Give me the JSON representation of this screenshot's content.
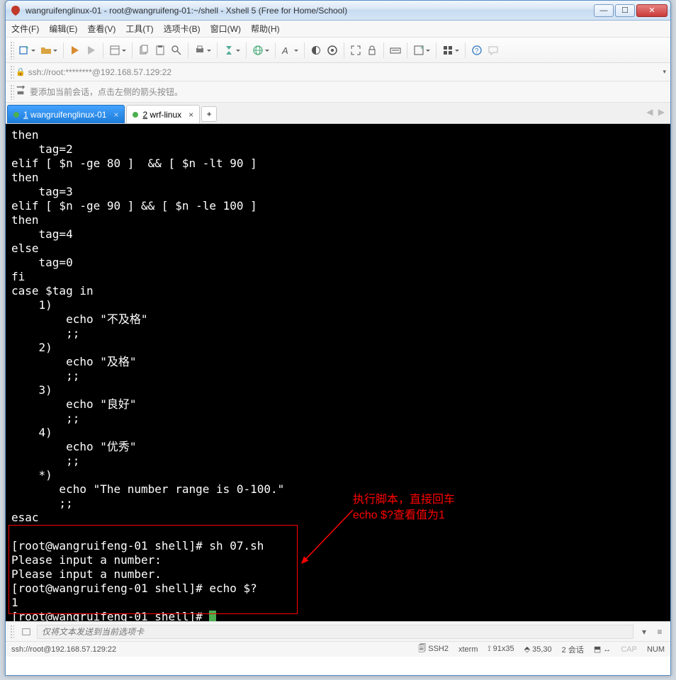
{
  "window": {
    "title": "wangruifenglinux-01 - root@wangruifeng-01:~/shell - Xshell 5 (Free for Home/School)"
  },
  "menu": {
    "file": "文件(F)",
    "edit": "编辑(E)",
    "view": "查看(V)",
    "tools": "工具(T)",
    "tabs": "选项卡(B)",
    "window": "窗口(W)",
    "help": "帮助(H)"
  },
  "address": {
    "url": "ssh://root:********@192.168.57.129:22"
  },
  "hint": {
    "text": "要添加当前会话，点击左侧的箭头按钮。"
  },
  "tabs": {
    "tab1": {
      "index": "1",
      "label": "wangruifenglinux-01"
    },
    "tab2": {
      "index": "2",
      "label": "wrf-linux"
    }
  },
  "terminal": {
    "content": "then\n    tag=2\nelif [ $n -ge 80 ]  && [ $n -lt 90 ]\nthen\n    tag=3\nelif [ $n -ge 90 ] && [ $n -le 100 ]\nthen\n    tag=4\nelse\n    tag=0\nfi\ncase $tag in\n    1)\n        echo \"不及格\"\n        ;;\n    2)\n        echo \"及格\"\n        ;;\n    3)\n        echo \"良好\"\n        ;;\n    4)\n        echo \"优秀\"\n        ;;\n    *)\n       echo \"The number range is 0-100.\"\n       ;;\nesac\n\n[root@wangruifeng-01 shell]# sh 07.sh\nPlease input a number:\nPlease input a number.\n[root@wangruifeng-01 shell]# echo $?\n1\n[root@wangruifeng-01 shell]# ",
    "annotation": "执行脚本，直接回车\necho $?查看值为1"
  },
  "input_strip": {
    "placeholder": "仅将文本发送到当前选项卡"
  },
  "status": {
    "left": "ssh://root@192.168.57.129:22",
    "proto": "SSH2",
    "term": "xterm",
    "size": "91x35",
    "pos": "35,30",
    "sessions": "2 会话",
    "cap": "CAP",
    "num": "NUM"
  }
}
